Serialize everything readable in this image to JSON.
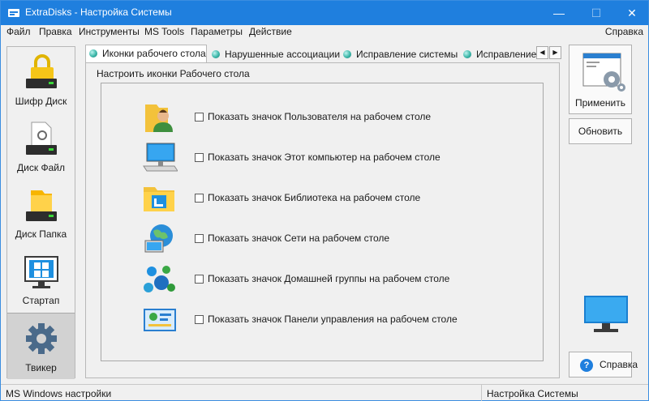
{
  "window": {
    "title": "ExtraDisks - Настройка Системы",
    "accent_color": "#1f7fde"
  },
  "menu": {
    "left": [
      "Файл",
      "Правка",
      "Инструменты",
      "MS Tools",
      "Параметры",
      "Действие"
    ],
    "right": "Справка"
  },
  "sidebar": {
    "items": [
      {
        "label": "Шифр Диск",
        "icon": "lock-disk-icon"
      },
      {
        "label": "Диск Файл",
        "icon": "file-disk-icon"
      },
      {
        "label": "Диск Папка",
        "icon": "folder-disk-icon"
      },
      {
        "label": "Стартап",
        "icon": "windows-startup-icon"
      },
      {
        "label": "Твикер",
        "icon": "gear-tweaker-icon",
        "active": true
      }
    ]
  },
  "tabs": [
    {
      "label": "Иконки рабочего стола",
      "active": true
    },
    {
      "label": "Нарушенные ассоциации"
    },
    {
      "label": "Исправление системы"
    },
    {
      "label": "Исправление"
    }
  ],
  "panel": {
    "group_label": "Настроить иконки Рабочего стола",
    "options": [
      {
        "text": "Показать значок Пользователя на рабочем столе",
        "checked": false,
        "icon": "user-folder-icon"
      },
      {
        "text": "Показать значок Этот компьютер на рабочем столе",
        "checked": false,
        "icon": "computer-icon"
      },
      {
        "text": "Показать значок Библиотека на рабочем столе",
        "checked": false,
        "icon": "library-icon"
      },
      {
        "text": "Показать значок Сети на рабочем столе",
        "checked": false,
        "icon": "network-icon"
      },
      {
        "text": "Показать значок Домашней группы на рабочем столе",
        "checked": false,
        "icon": "homegroup-icon"
      },
      {
        "text": "Показать значок Панели управления на рабочем столе",
        "checked": false,
        "icon": "control-panel-icon"
      }
    ]
  },
  "buttons": {
    "apply": "Применить",
    "refresh": "Обновить",
    "help": "Справка"
  },
  "status": {
    "left": "MS Windows настройки",
    "right": "Настройка Системы"
  }
}
